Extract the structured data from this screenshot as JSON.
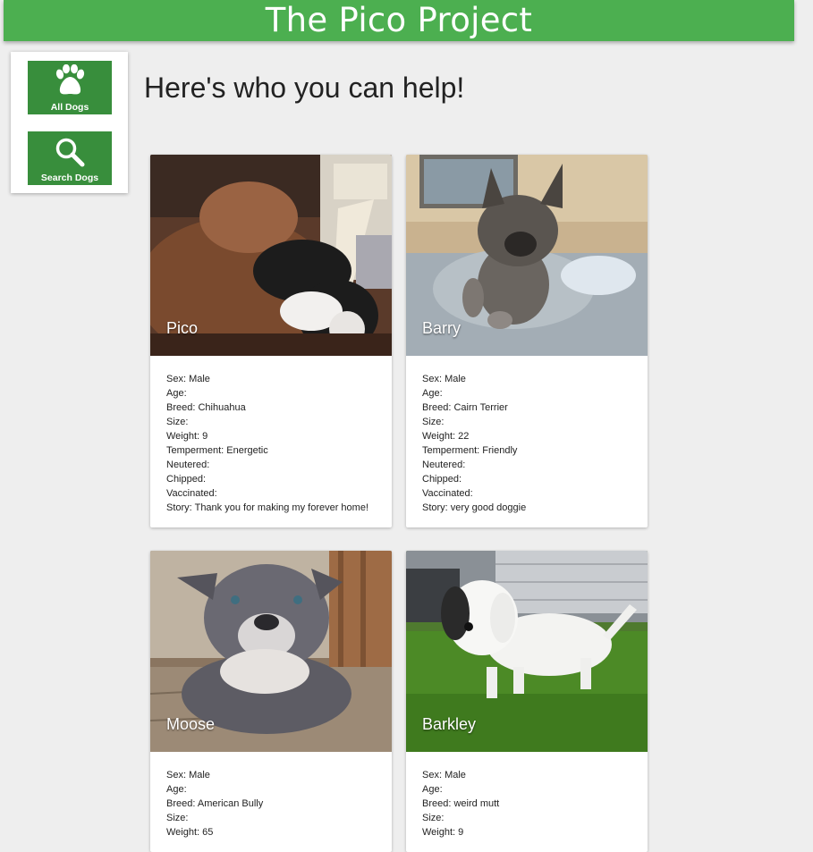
{
  "header": {
    "title": "The Pico Project"
  },
  "sidenav": {
    "all_dogs": {
      "label": "All Dogs",
      "icon": "paw-icon"
    },
    "search_dogs": {
      "label": "Search Dogs",
      "icon": "search-icon"
    }
  },
  "main": {
    "heading": "Here's who you can help!"
  },
  "colors": {
    "header": "#4caf50",
    "nav_button": "#388e3c",
    "background": "#eeeeee"
  },
  "dogs": [
    {
      "name": "Pico",
      "fields": [
        {
          "label": "Sex:",
          "value": "Male"
        },
        {
          "label": "Age:",
          "value": ""
        },
        {
          "label": "Breed:",
          "value": "Chihuahua"
        },
        {
          "label": "Size:",
          "value": ""
        },
        {
          "label": "Weight:",
          "value": "9"
        },
        {
          "label": "Temperment:",
          "value": "Energetic"
        },
        {
          "label": "Neutered:",
          "value": ""
        },
        {
          "label": "Chipped:",
          "value": ""
        },
        {
          "label": "Vaccinated:",
          "value": ""
        },
        {
          "label": "Story:",
          "value": "Thank you for making my forever home!"
        }
      ]
    },
    {
      "name": "Barry",
      "fields": [
        {
          "label": "Sex:",
          "value": "Male"
        },
        {
          "label": "Age:",
          "value": ""
        },
        {
          "label": "Breed:",
          "value": "Cairn Terrier"
        },
        {
          "label": "Size:",
          "value": ""
        },
        {
          "label": "Weight:",
          "value": "22"
        },
        {
          "label": "Temperment:",
          "value": "Friendly"
        },
        {
          "label": "Neutered:",
          "value": ""
        },
        {
          "label": "Chipped:",
          "value": ""
        },
        {
          "label": "Vaccinated:",
          "value": ""
        },
        {
          "label": "Story:",
          "value": "very good doggie"
        }
      ]
    },
    {
      "name": "Moose",
      "fields": [
        {
          "label": "Sex:",
          "value": "Male"
        },
        {
          "label": "Age:",
          "value": ""
        },
        {
          "label": "Breed:",
          "value": "American Bully"
        },
        {
          "label": "Size:",
          "value": ""
        },
        {
          "label": "Weight:",
          "value": "65"
        }
      ]
    },
    {
      "name": "Barkley",
      "fields": [
        {
          "label": "Sex:",
          "value": "Male"
        },
        {
          "label": "Age:",
          "value": ""
        },
        {
          "label": "Breed:",
          "value": "weird mutt"
        },
        {
          "label": "Size:",
          "value": ""
        },
        {
          "label": "Weight:",
          "value": "9"
        }
      ]
    }
  ]
}
